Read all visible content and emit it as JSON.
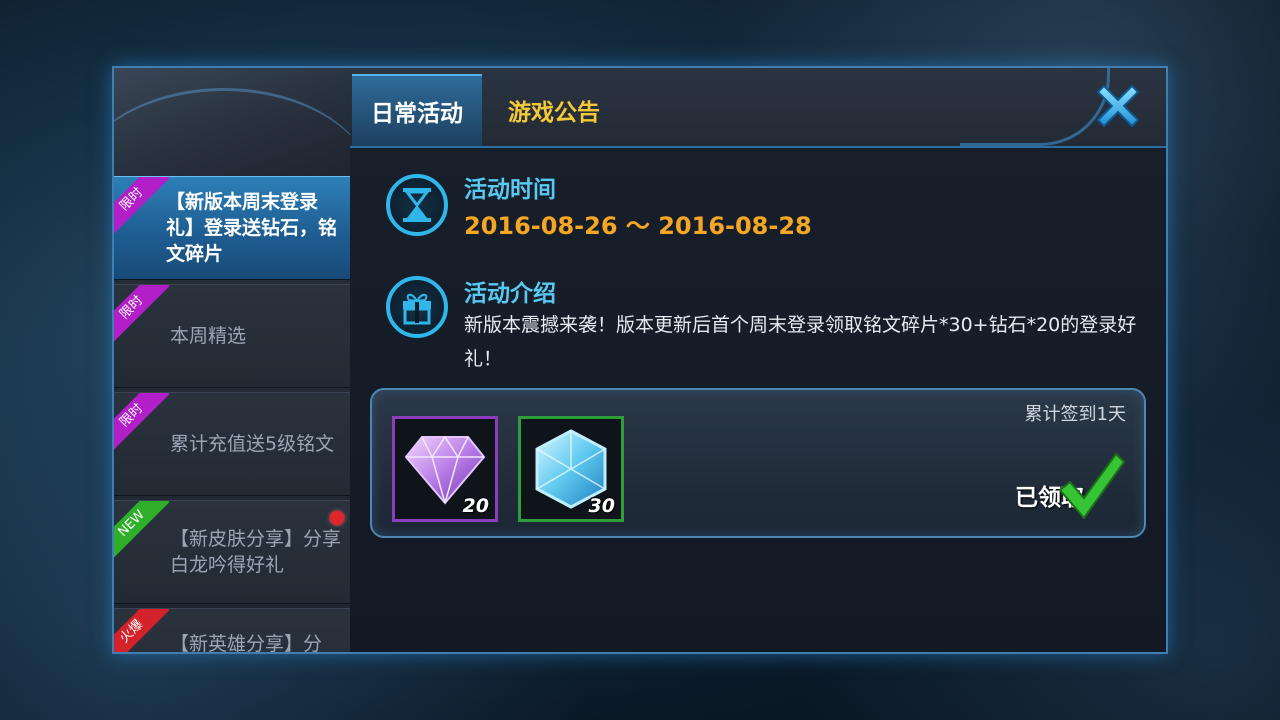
{
  "header": {
    "tabs": [
      {
        "label": "日常活动",
        "active": true
      },
      {
        "label": "游戏公告",
        "active": false
      }
    ]
  },
  "sidebar": {
    "items": [
      {
        "badge": "限时",
        "badge_color": "#b21ec8",
        "label": "【新版本周末登录礼】登录送钻石，铭文碎片",
        "active": true,
        "new_dot": false
      },
      {
        "badge": "限时",
        "badge_color": "#b21ec8",
        "label": "本周精选",
        "active": false,
        "new_dot": false
      },
      {
        "badge": "限时",
        "badge_color": "#b21ec8",
        "label": "累计充值送5级铭文",
        "active": false,
        "new_dot": false
      },
      {
        "badge": "NEW",
        "badge_color": "#2fae2a",
        "label": "【新皮肤分享】分享白龙吟得好礼",
        "active": false,
        "new_dot": true
      },
      {
        "badge": "火爆",
        "badge_color": "#d3222a",
        "label": "【新英雄分享】分",
        "active": false,
        "new_dot": false
      }
    ]
  },
  "activity": {
    "time_title": "活动时间",
    "time_range": "2016-08-26 ～ 2016-08-28",
    "intro_title": "活动介绍",
    "intro_text": "新版本震撼来袭！版本更新后首个周末登录领取铭文碎片*30+钻石*20的登录好礼！"
  },
  "reward": {
    "items": [
      {
        "name": "diamond-icon",
        "quantity": "20",
        "border_color": "#8a3dbd"
      },
      {
        "name": "inscription-shard-icon",
        "quantity": "30",
        "border_color": "#2e9e3b"
      }
    ],
    "sign_status": "累计签到1天",
    "claim_status": "已领取"
  },
  "colors": {
    "accent": "#58c8f0",
    "date": "#f5a623",
    "tab_inactive": "#f5c935",
    "frame": "#3d7fb3"
  }
}
